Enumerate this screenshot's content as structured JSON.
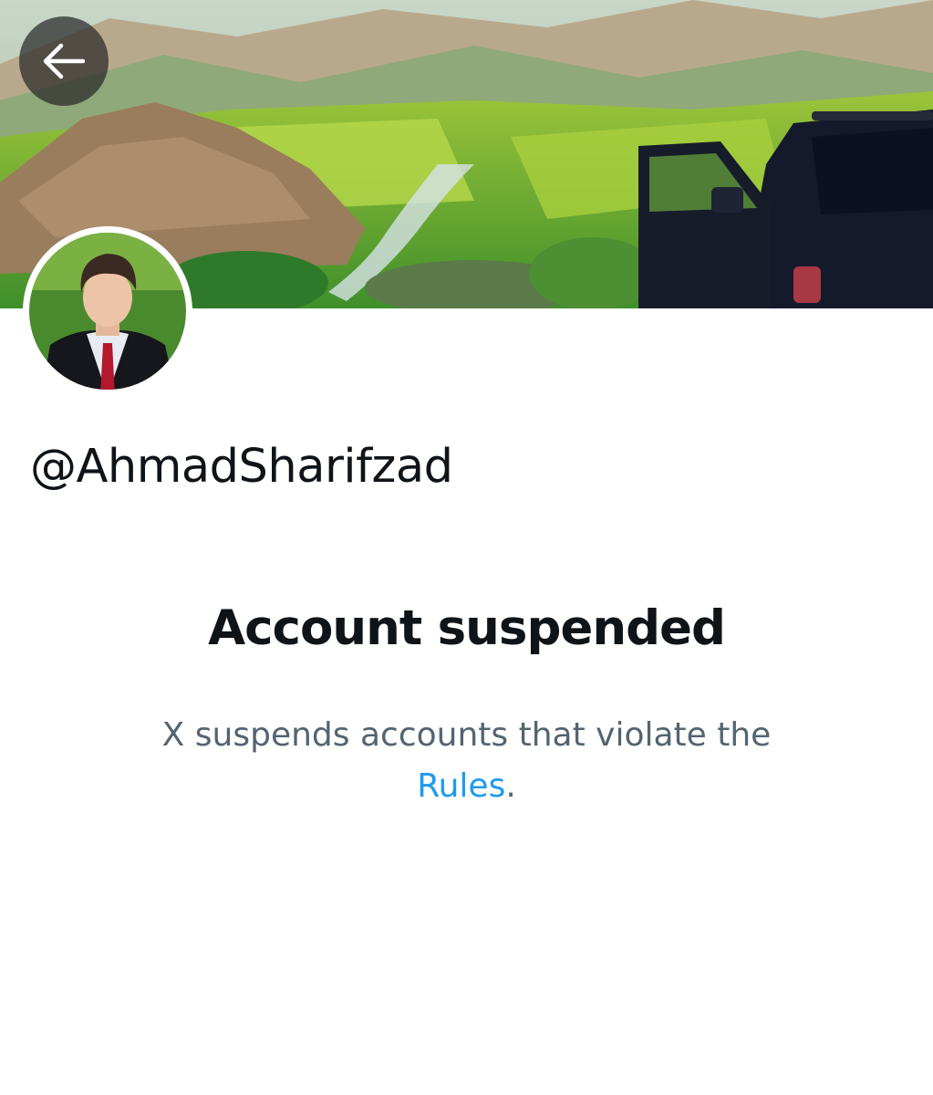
{
  "header": {
    "back_icon": "arrow-left-icon",
    "banner_image": "landscape-valley-with-suv-photo"
  },
  "profile": {
    "avatar_image": "profile-photo-man-in-suit",
    "handle": "@AhmadSharifzad"
  },
  "suspension": {
    "title": "Account suspended",
    "message": "X suspends accounts that violate the",
    "link_text": "Rules",
    "trailing": "."
  },
  "colors": {
    "text_primary": "#0f1419",
    "text_secondary": "#536471",
    "link": "#1d9bf0"
  }
}
